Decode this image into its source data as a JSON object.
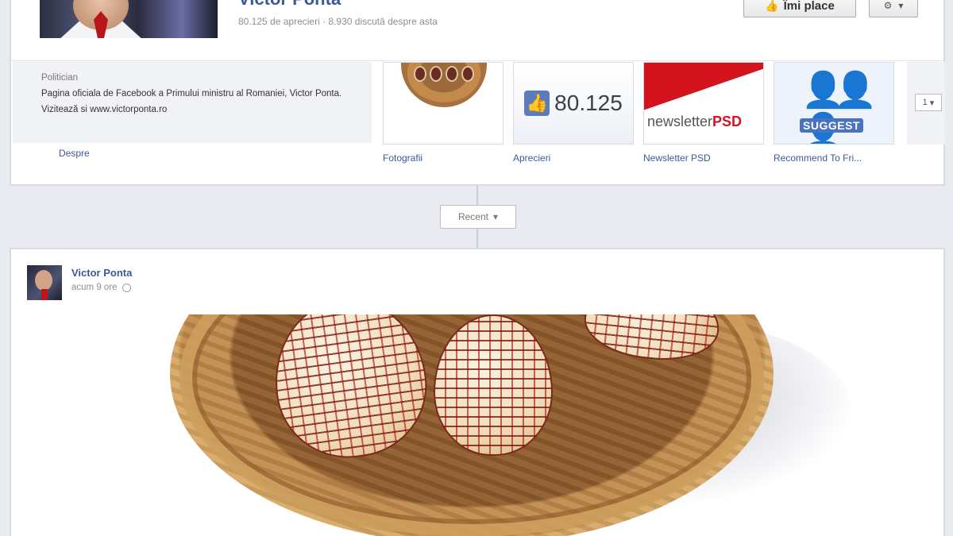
{
  "page": {
    "name": "Victor Ponta",
    "stats": "80.125 de aprecieri · 8.930 discută despre asta"
  },
  "actions": {
    "like_label": "Îmi place",
    "gear_icon": "gear-icon"
  },
  "about": {
    "category": "Politician",
    "description": "Pagina oficiala de Facebook a Primului ministru al Romaniei, Victor Ponta. Vizitează si www.victorponta.ro",
    "label": "Despre"
  },
  "apps": [
    {
      "label": "Fotografii"
    },
    {
      "label": "Aprecieri",
      "count": "80.125"
    },
    {
      "label": "Newsletter PSD",
      "tile_text_1": "newsletter",
      "tile_text_2": "PSD"
    },
    {
      "label": "Recommend To Fri...",
      "tile_text": "SUGGEST"
    }
  ],
  "more": {
    "count": "1"
  },
  "timeline": {
    "period_label": "Recent"
  },
  "post": {
    "author": "Victor Ponta",
    "time": "acum 9 ore"
  },
  "colors": {
    "link_blue": "#3b5998",
    "psd_red": "#d3141f",
    "background": "#e9ebf0"
  }
}
